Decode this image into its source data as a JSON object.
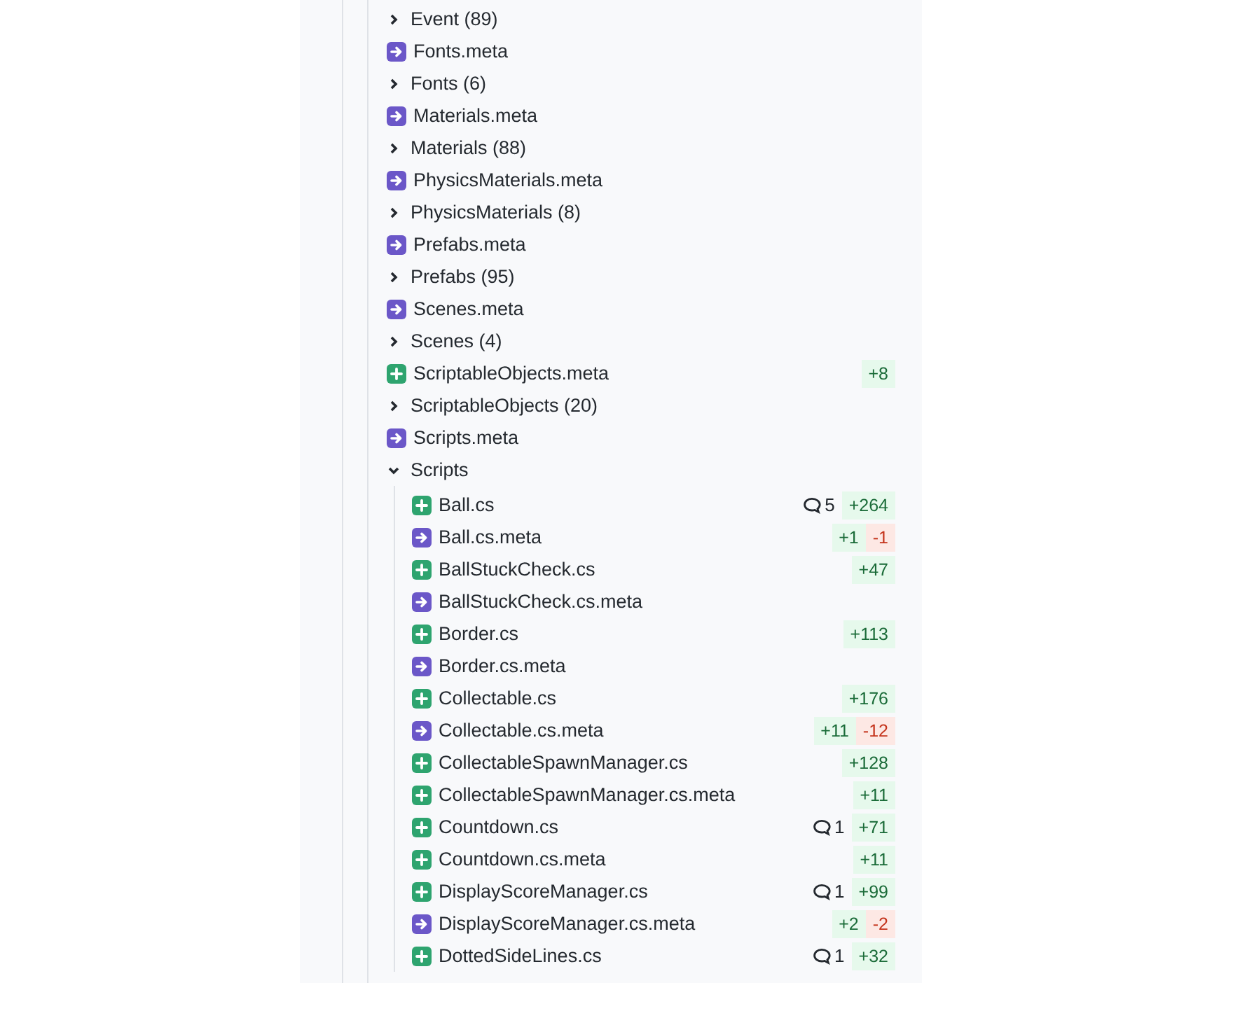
{
  "file_tree": {
    "items": [
      {
        "kind": "folder",
        "label": "Event (89)",
        "expanded": false
      },
      {
        "kind": "moved",
        "name": "Fonts.meta"
      },
      {
        "kind": "folder",
        "label": "Fonts (6)",
        "expanded": false
      },
      {
        "kind": "moved",
        "name": "Materials.meta"
      },
      {
        "kind": "folder",
        "label": "Materials (88)",
        "expanded": false
      },
      {
        "kind": "moved",
        "name": "PhysicsMaterials.meta"
      },
      {
        "kind": "folder",
        "label": "PhysicsMaterials (8)",
        "expanded": false
      },
      {
        "kind": "moved",
        "name": "Prefabs.meta"
      },
      {
        "kind": "folder",
        "label": "Prefabs (95)",
        "expanded": false
      },
      {
        "kind": "moved",
        "name": "Scenes.meta"
      },
      {
        "kind": "folder",
        "label": "Scenes (4)",
        "expanded": false
      },
      {
        "kind": "added",
        "name": "ScriptableObjects.meta",
        "additions": "+8"
      },
      {
        "kind": "folder",
        "label": "ScriptableObjects (20)",
        "expanded": false
      },
      {
        "kind": "moved",
        "name": "Scripts.meta"
      },
      {
        "kind": "folder",
        "label": "Scripts",
        "expanded": true,
        "children": [
          {
            "kind": "added",
            "name": "Ball.cs",
            "comments": "5",
            "additions": "+264"
          },
          {
            "kind": "moved",
            "name": "Ball.cs.meta",
            "additions": "+1",
            "deletions": "-1"
          },
          {
            "kind": "added",
            "name": "BallStuckCheck.cs",
            "additions": "+47"
          },
          {
            "kind": "moved",
            "name": "BallStuckCheck.cs.meta"
          },
          {
            "kind": "added",
            "name": "Border.cs",
            "additions": "+113"
          },
          {
            "kind": "moved",
            "name": "Border.cs.meta"
          },
          {
            "kind": "added",
            "name": "Collectable.cs",
            "additions": "+176"
          },
          {
            "kind": "moved",
            "name": "Collectable.cs.meta",
            "additions": "+11",
            "deletions": "-12"
          },
          {
            "kind": "added",
            "name": "CollectableSpawnManager.cs",
            "additions": "+128"
          },
          {
            "kind": "added",
            "name": "CollectableSpawnManager.cs.meta",
            "additions": "+11"
          },
          {
            "kind": "added",
            "name": "Countdown.cs",
            "comments": "1",
            "additions": "+71"
          },
          {
            "kind": "added",
            "name": "Countdown.cs.meta",
            "additions": "+11"
          },
          {
            "kind": "added",
            "name": "DisplayScoreManager.cs",
            "comments": "1",
            "additions": "+99"
          },
          {
            "kind": "moved",
            "name": "DisplayScoreManager.cs.meta",
            "additions": "+2",
            "deletions": "-2"
          },
          {
            "kind": "added",
            "name": "DottedSideLines.cs",
            "comments": "1",
            "additions": "+32"
          }
        ]
      }
    ]
  }
}
